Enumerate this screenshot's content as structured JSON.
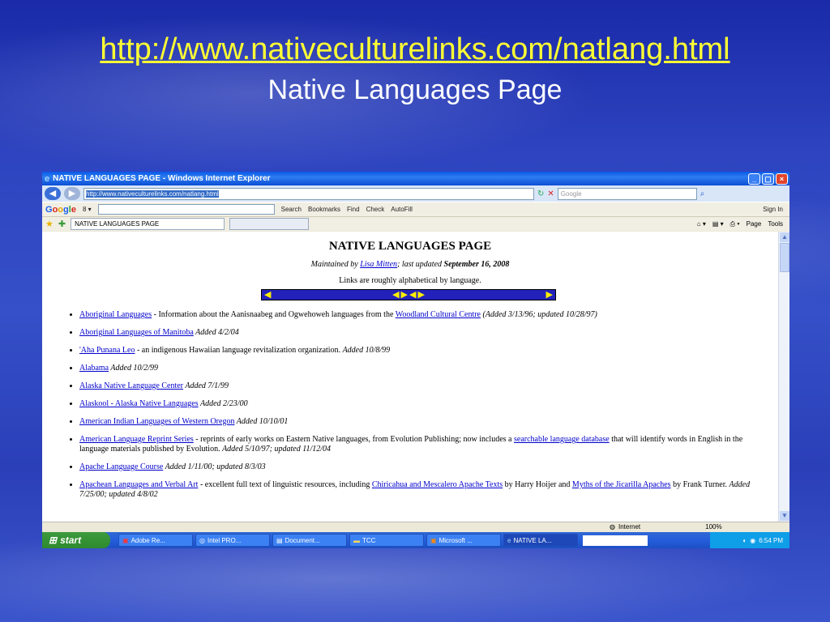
{
  "slide": {
    "url": "http://www.nativeculturelinks.com/natlang.html",
    "subtitle": "Native Languages Page"
  },
  "browser": {
    "window_title": "NATIVE LANGUAGES PAGE - Windows Internet Explorer",
    "address": "http://www.nativeculturelinks.com/natlang.html",
    "search_placeholder": "Google",
    "tab_title": "NATIVE LANGUAGES PAGE",
    "google_toolbar": {
      "logo": "Google",
      "items": [
        "Search",
        "Bookmarks",
        "Find",
        "Check",
        "AutoFill"
      ],
      "sign_in": "Sign In"
    },
    "command_bar": [
      "Page",
      "Tools"
    ],
    "status": {
      "zone": "Internet",
      "zoom": "100%"
    }
  },
  "page": {
    "title": "NATIVE LANGUAGES PAGE",
    "maintained_prefix": "Maintained by",
    "maintainer": "Lisa Mitten",
    "updated_prefix": "; last updated",
    "updated_date": "September 16, 2008",
    "links_note": "Links are roughly alphabetical by language.",
    "entries": [
      {
        "link": "Aboriginal Languages",
        "text": " - Information about the Aanisnaabeg and Ogwehoweh languages from the ",
        "link2": "Woodland Cultural Centre",
        "note": " (Added 3/13/96; updated 10/28/97)"
      },
      {
        "link": "Aboriginal Languages of Manitoba",
        "note": " Added 4/2/04"
      },
      {
        "link": "'Aha Punana Leo",
        "text": " - an indigenous Hawaiian language revitalization organization. ",
        "note": "Added 10/8/99"
      },
      {
        "link": "Alabama",
        "note": " Added 10/2/99"
      },
      {
        "link": "Alaska Native Language Center",
        "note": " Added 7/1/99"
      },
      {
        "link": "Alaskool - Alaska Native Languages",
        "note": " Added 2/23/00"
      },
      {
        "link": "American Indian Languages of Western Oregon",
        "note": " Added 10/10/01"
      },
      {
        "link": "American Language Reprint Series",
        "text": " - reprints of early works on Eastern Native languages, from Evolution Publishing; now includes a ",
        "link2": "searchable language database",
        "text2": " that will identify words in English in the language materials published by Evolution. ",
        "note": "Added 5/10/97; updated 11/12/04"
      },
      {
        "link": "Apache Language Course",
        "note": " Added 1/11/00; updated 8/3/03"
      },
      {
        "link": "Apachean Languages and Verbal Art",
        "text": " - excellent full text of linguistic resources, including ",
        "link2": "Chiricahua and Mescalero Apache Texts",
        "text2": " by Harry Hoijer and ",
        "link3": "Myths of the Jicarilla Apaches",
        "text3": " by Frank Turner. ",
        "note": "Added 7/25/00; updated 4/8/02"
      }
    ]
  },
  "taskbar": {
    "start": "start",
    "tasks": [
      "Adobe Re...",
      "Intel PRO...",
      "Document...",
      "TCC",
      "Microsoft ...",
      "NATIVE LA..."
    ],
    "clock": "6:54 PM"
  }
}
